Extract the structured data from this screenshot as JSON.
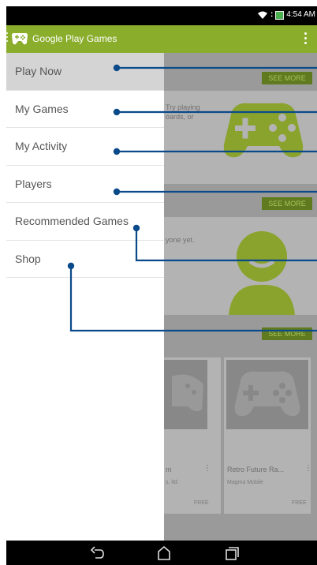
{
  "status_bar": {
    "time": "4:54 AM"
  },
  "app_bar": {
    "title": "Google Play Games"
  },
  "drawer": {
    "items": [
      {
        "label": "Play Now",
        "active": true
      },
      {
        "label": "My Games",
        "active": false
      },
      {
        "label": "My Activity",
        "active": false
      },
      {
        "label": "Players",
        "active": false
      },
      {
        "label": "Recommended Games",
        "active": false
      },
      {
        "label": "Shop",
        "active": false
      }
    ]
  },
  "background": {
    "see_more_1": "SEE MORE",
    "see_more_2": "SEE MORE",
    "see_more_3": "SEE MORE",
    "card1_text_line1": "Try playing",
    "card1_text_line2": "oards, or",
    "card2_text": "yone yet.",
    "game1_title": "m",
    "game1_developer": "s, ltd.",
    "game1_price": "FREE",
    "game2_title": "Retro Future Ra...",
    "game2_developer": "Magma Mobile",
    "game2_price": "FREE"
  },
  "colors": {
    "accent": "#8aad2c",
    "callout": "#0a4a8a",
    "overlay": "#9a9a9a"
  }
}
